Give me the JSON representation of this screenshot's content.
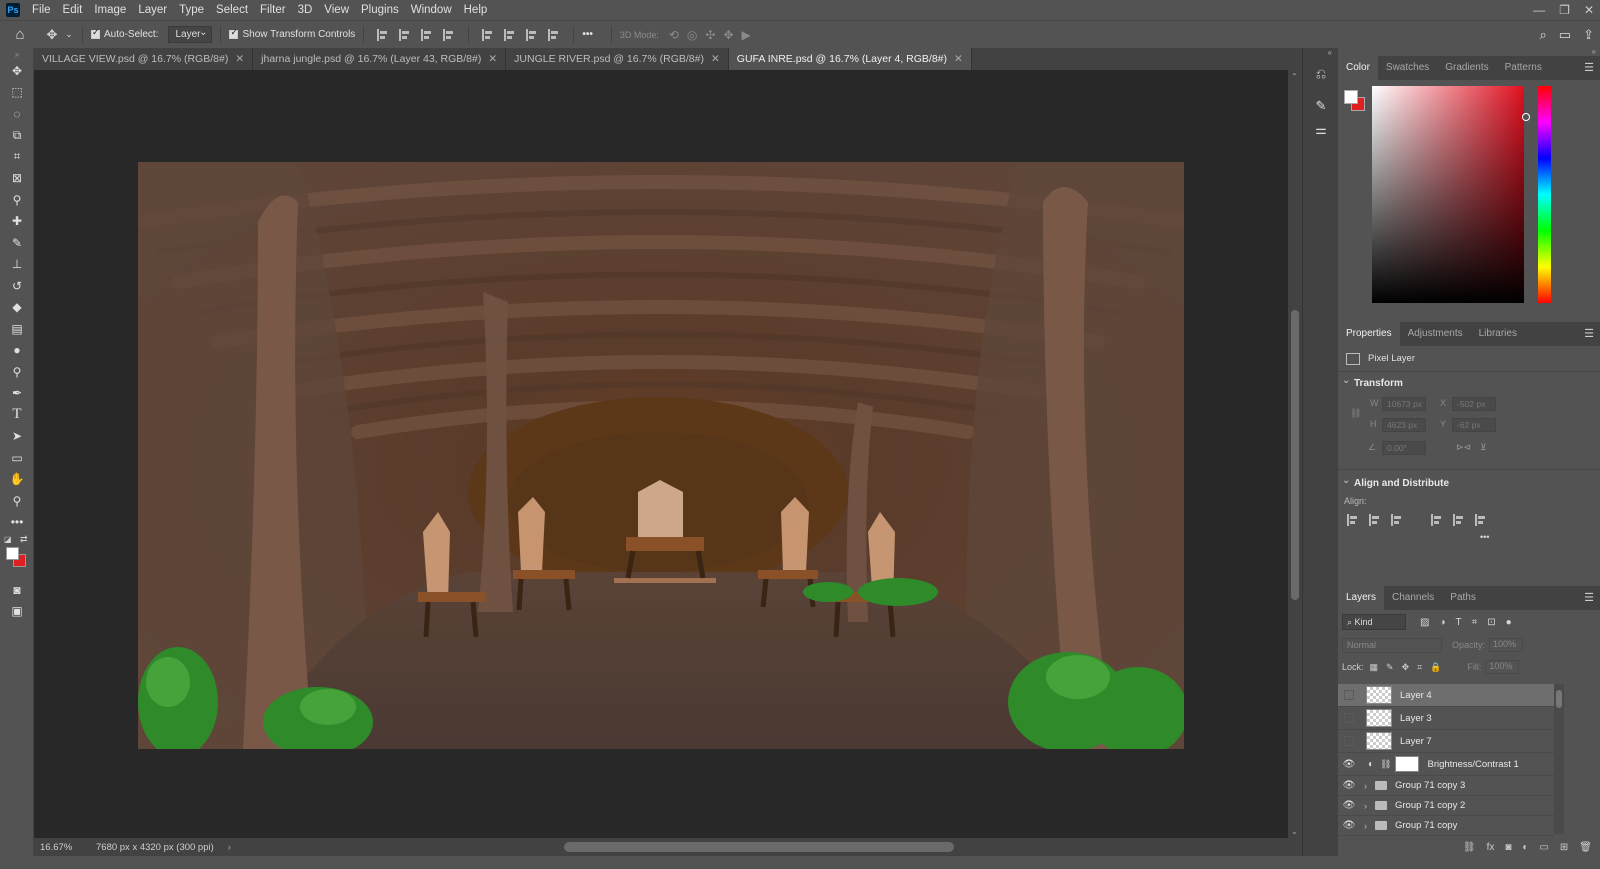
{
  "app": {
    "logo": "Ps"
  },
  "menu": [
    "File",
    "Edit",
    "Image",
    "Layer",
    "Type",
    "Select",
    "Filter",
    "3D",
    "View",
    "Plugins",
    "Window",
    "Help"
  ],
  "options": {
    "auto_select_label": "Auto-Select:",
    "layer_value": "Layer",
    "show_transform_label": "Show Transform Controls",
    "more_label": "•••",
    "mode3d_label": "3D Mode:"
  },
  "tabs": [
    {
      "label": "VILLAGE VIEW.psd @ 16.7% (RGB/8#)",
      "active": false
    },
    {
      "label": "jharna jungle.psd @ 16.7% (Layer 43, RGB/8#)",
      "active": false
    },
    {
      "label": "JUNGLE RIVER.psd @ 16.7% (RGB/8#)",
      "active": false
    },
    {
      "label": "GUFA INRE.psd @ 16.7% (Layer 4, RGB/8#)",
      "active": true
    }
  ],
  "status": {
    "zoom": "16.67%",
    "doc_info": "7680 px x 4320 px (300 ppi)"
  },
  "color_panel": {
    "tabs": [
      "Color",
      "Swatches",
      "Gradients",
      "Patterns"
    ],
    "fg_color": "#ffffff",
    "bg_color": "#e02020"
  },
  "properties": {
    "tabs": [
      "Properties",
      "Adjustments",
      "Libraries"
    ],
    "kind_label": "Pixel Layer",
    "transform_label": "Transform",
    "w_label": "W",
    "w_value": "10673 px",
    "x_label": "X",
    "x_value": "-502 px",
    "h_label": "H",
    "h_value": "4623 px",
    "y_label": "Y",
    "y_value": "-62 px",
    "angle_value": "0.00°",
    "align_label": "Align and Distribute",
    "align_sub": "Align:",
    "more": "•••"
  },
  "layers": {
    "tabs": [
      "Layers",
      "Channels",
      "Paths"
    ],
    "filter_kind": "Kind",
    "blend_mode": "Normal",
    "opacity_label": "Opacity:",
    "opacity_value": "100%",
    "lock_label": "Lock:",
    "fill_label": "Fill:",
    "fill_value": "100%",
    "items": [
      {
        "name": "Layer 4",
        "type": "pixel",
        "visible": false,
        "selected": true
      },
      {
        "name": "Layer 3",
        "type": "pixel",
        "visible": false,
        "selected": false
      },
      {
        "name": "Layer 7",
        "type": "pixel",
        "visible": false,
        "selected": false
      },
      {
        "name": "Brightness/Contrast 1",
        "type": "adjustment",
        "visible": true,
        "selected": false
      },
      {
        "name": "Group 71 copy 3",
        "type": "group",
        "visible": true,
        "selected": false
      },
      {
        "name": "Group 71 copy 2",
        "type": "group",
        "visible": true,
        "selected": false
      },
      {
        "name": "Group 71 copy",
        "type": "group",
        "visible": true,
        "selected": false
      }
    ]
  },
  "tool_icons": [
    "move-tool",
    "marquee-tool",
    "lasso-tool",
    "object-select-tool",
    "crop-tool",
    "frame-tool",
    "eyedropper-tool",
    "healing-brush-tool",
    "brush-tool",
    "clone-stamp-tool",
    "history-brush-tool",
    "eraser-tool",
    "gradient-tool",
    "blur-tool",
    "dodge-tool",
    "pen-tool",
    "type-tool",
    "path-select-tool",
    "rectangle-tool",
    "hand-tool",
    "zoom-tool",
    "more-tools"
  ]
}
